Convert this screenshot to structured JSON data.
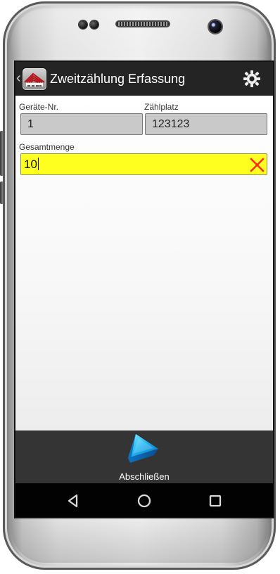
{
  "app": {
    "title": "Zweitzählung Erfassung",
    "logo_icon": "app-logo-icon",
    "settings_icon": "gear-icon",
    "colors": {
      "app_bar": "#242424",
      "input_highlight": "#ffff1f",
      "clear_icon": "#ff2a00",
      "toolbar": "#343434",
      "navigation_bar": "#020202"
    }
  },
  "form": {
    "device_label": "Geräte-Nr.",
    "device_value": "1",
    "place_label": "Zählplatz",
    "place_value": "123123",
    "quantity_label": "Gesamtmenge",
    "quantity_value": "10",
    "clear_icon": "close-icon"
  },
  "toolbar": {
    "finish_label": "Abschließen",
    "finish_icon": "play-arrow-icon"
  },
  "navigation": {
    "back_icon": "back-triangle-icon",
    "home_icon": "home-circle-icon",
    "recents_icon": "recents-square-icon"
  }
}
